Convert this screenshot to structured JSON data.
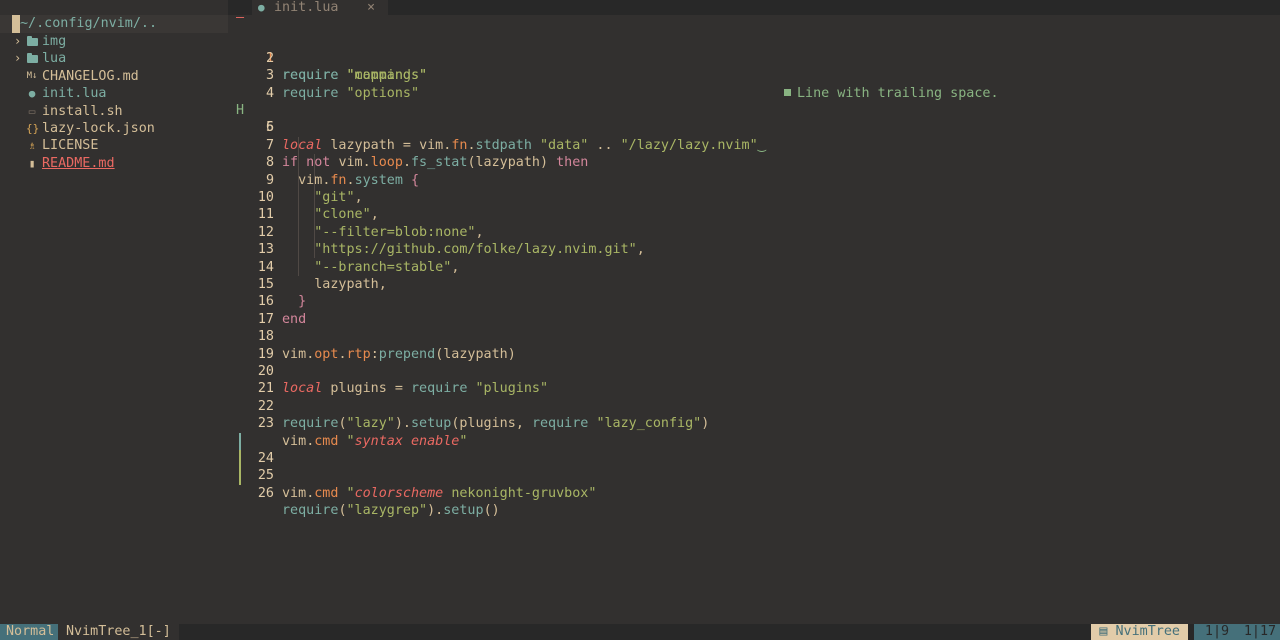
{
  "tree": {
    "header": "~/.config/nvim/..",
    "items": [
      {
        "label": "img",
        "icon": "folder-icon",
        "type": "folder"
      },
      {
        "label": "lua",
        "icon": "folder-icon",
        "type": "folder"
      },
      {
        "label": "CHANGELOG.md",
        "icon": "markdown-icon",
        "type": "file"
      },
      {
        "label": "init.lua",
        "icon": "lua-icon",
        "type": "file"
      },
      {
        "label": "install.sh",
        "icon": "shell-icon",
        "type": "file"
      },
      {
        "label": "lazy-lock.json",
        "icon": "json-icon",
        "type": "file"
      },
      {
        "label": "LICENSE",
        "icon": "license-icon",
        "type": "file"
      },
      {
        "label": "README.md",
        "icon": "readme-icon",
        "type": "file"
      }
    ]
  },
  "tab": {
    "title": "init.lua",
    "close": "×"
  },
  "signs": {
    "line1": "–",
    "line5": "H"
  },
  "diagnostic": "Line with trailing space.",
  "status": {
    "mode": "Normal",
    "buffer": "NvimTree_1[-]",
    "filetype": "NvimTree",
    "pos": "1|9",
    "progress": "1|17"
  },
  "colors": {
    "bg": "#32302f",
    "accent": "#7daea3",
    "string": "#a9b665",
    "keyword": "#d3869b",
    "local": "#ea6962",
    "number": "#e78a4e"
  }
}
